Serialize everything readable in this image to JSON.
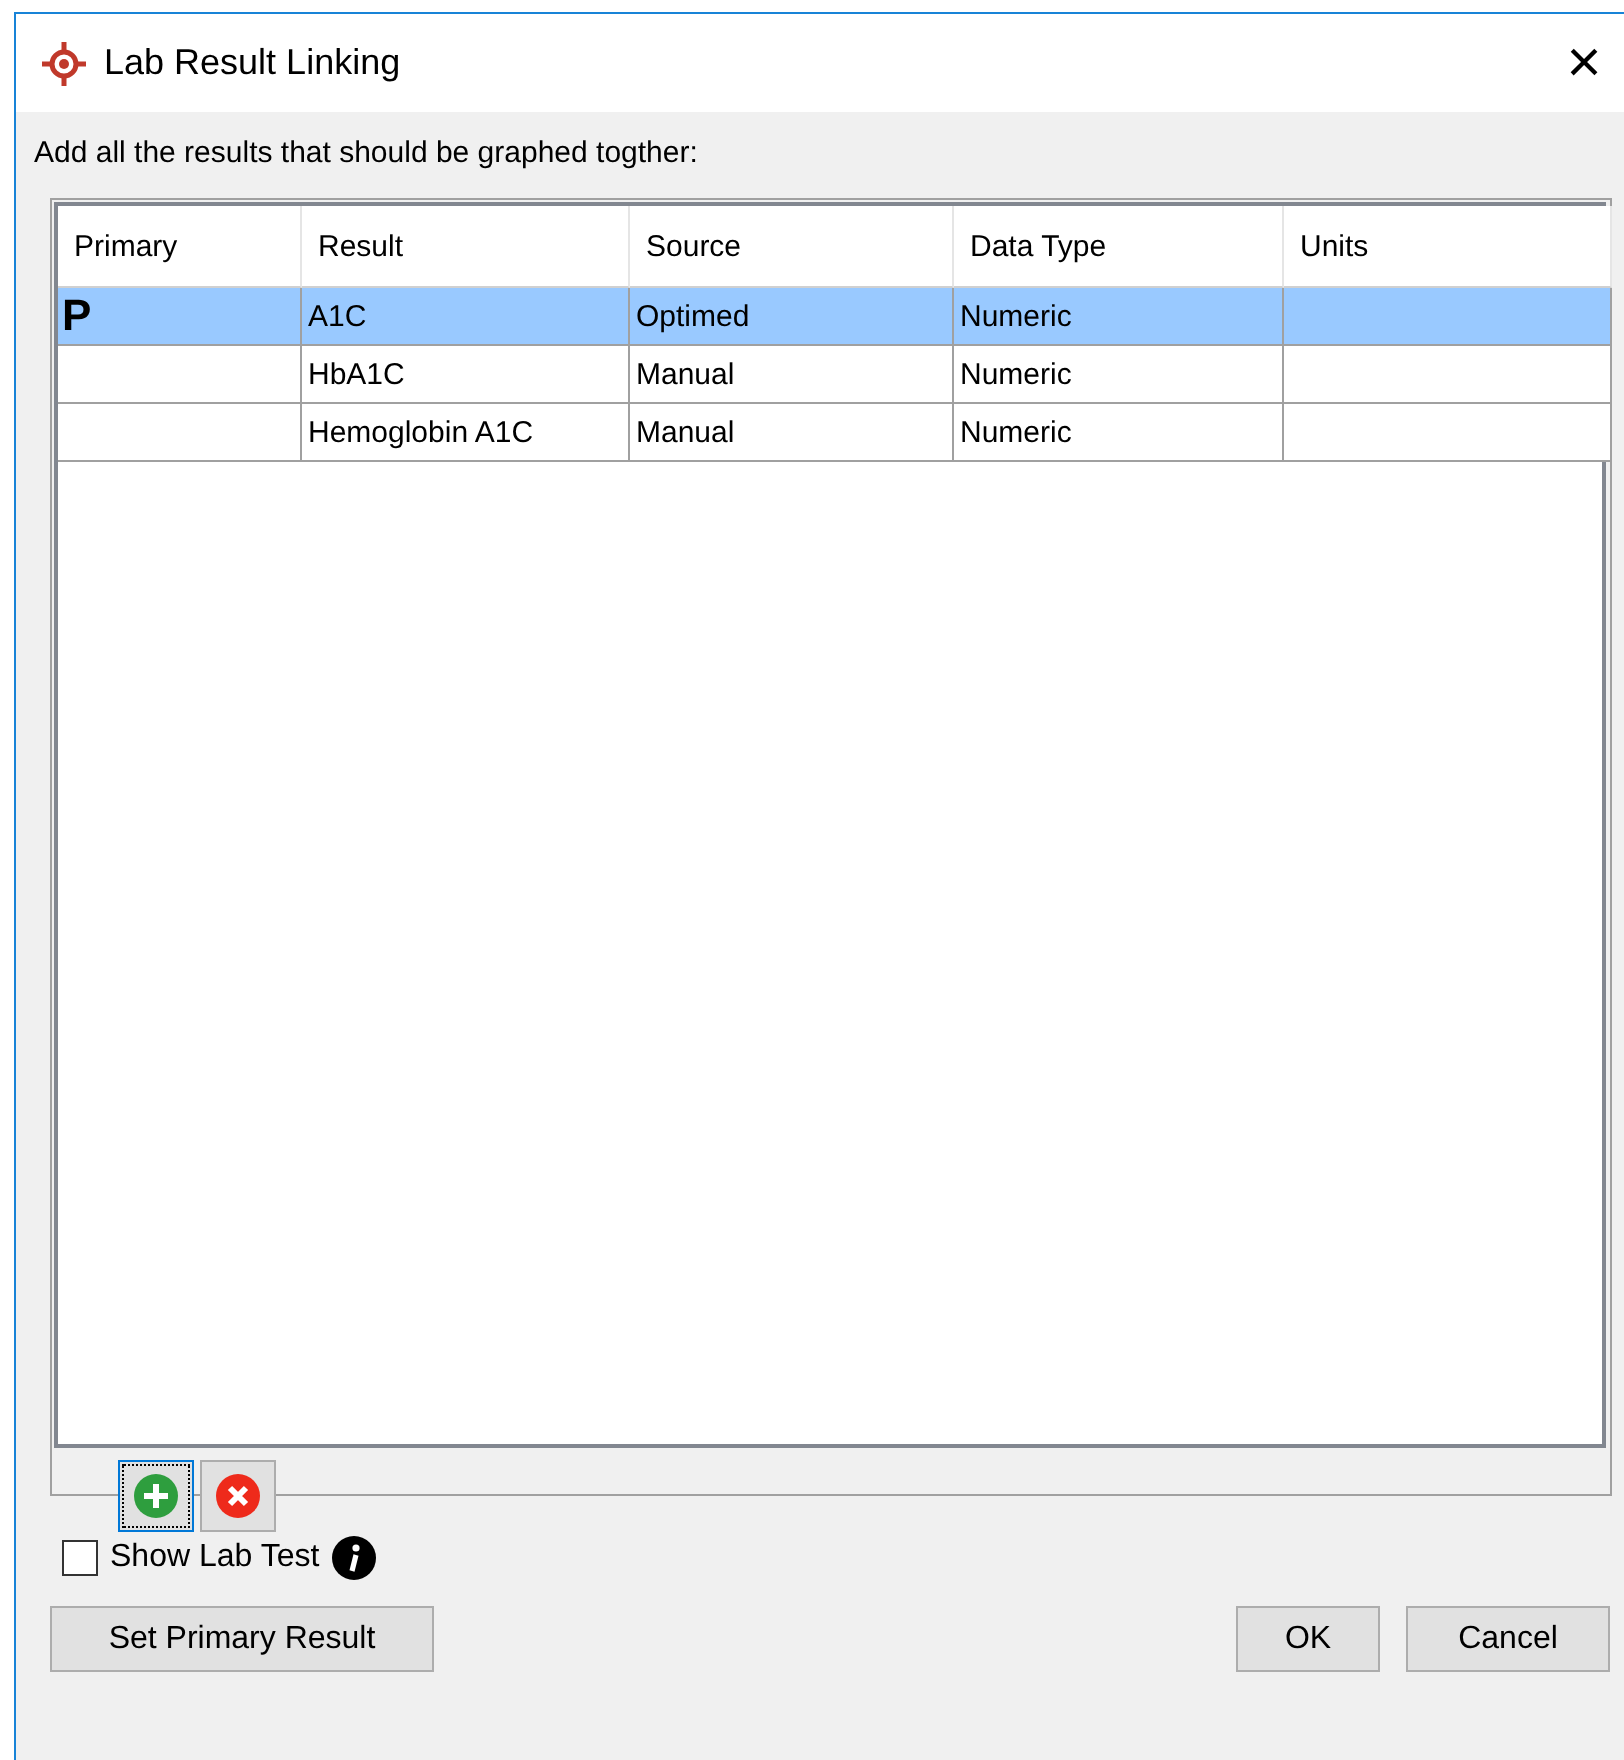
{
  "window": {
    "title": "Lab Result Linking",
    "close": "×"
  },
  "instruction": "Add all the results that should be graphed togther:",
  "table": {
    "columns": [
      "Primary",
      "Result",
      "Source",
      "Data Type",
      "Units"
    ],
    "rows": [
      {
        "cells": [
          "P",
          "A1C",
          "Optimed",
          "Numeric",
          ""
        ],
        "selected": true
      },
      {
        "cells": [
          "",
          "HbA1C",
          "Manual",
          "Numeric",
          ""
        ],
        "selected": false
      },
      {
        "cells": [
          "",
          "Hemoglobin A1C",
          "Manual",
          "Numeric",
          ""
        ],
        "selected": false
      }
    ]
  },
  "show_lab_test": {
    "label": "Show Lab Test",
    "checked": false
  },
  "buttons": {
    "set_primary": "Set Primary Result",
    "ok": "OK",
    "cancel": "Cancel"
  }
}
